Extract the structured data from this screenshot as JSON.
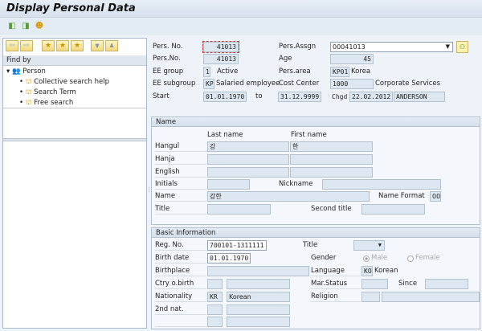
{
  "window": {
    "title": "Display Personal Data"
  },
  "toolbar": {
    "icons": [
      "previous-record-icon",
      "next-record-icon",
      "person-overview-icon"
    ]
  },
  "left_panel": {
    "toolbar_icons": [
      "arrow-left-icon",
      "arrow-right-icon",
      "favorite-add-icon",
      "favorite-icon",
      "favorite-edit-icon",
      "expand-down-icon",
      "collapse-up-icon"
    ],
    "find_by": "Find by",
    "tree": {
      "root": "Person",
      "items": [
        "Collective search help",
        "Search Term",
        "Free search"
      ]
    }
  },
  "header": {
    "pers_no_label": "Pers. No.",
    "pers_no": "41013",
    "pers_no2_label": "Pers.No.",
    "pers_no2": "41013",
    "ee_group_label": "EE group",
    "ee_group_code": "1",
    "ee_group_text": "Active",
    "ee_subgroup_label": "EE subgroup",
    "ee_subgroup_code": "KP",
    "ee_subgroup_text": "Salaried employee",
    "start_label": "Start",
    "start": "01.01.1970",
    "to_label": "to",
    "end": "31.12.9999",
    "pers_assgn_label": "Pers.Assgn",
    "pers_assgn": "00041013",
    "age_label": "Age",
    "age": "45",
    "pers_area_label": "Pers.area",
    "pers_area_code": "KP01",
    "pers_area_text": "Korea",
    "cost_center_label": "Cost Center",
    "cost_center": "1000",
    "cost_center_text": "Corporate Services",
    "chgd_label": "Chgd",
    "chgd_date": "22.02.2012",
    "chgd_by": "ANDERSON"
  },
  "name_group": {
    "title": "Name",
    "last_name_header": "Last name",
    "first_name_header": "First name",
    "hangul_label": "Hangul",
    "hangul_last": "강",
    "hangul_first": "한",
    "hanja_label": "Hanja",
    "english_label": "English",
    "initials_label": "Initials",
    "nickname_label": "Nickname",
    "name_label": "Name",
    "name": "강한",
    "name_format_label": "Name Format",
    "name_format": "00",
    "title_label": "Title",
    "second_title_label": "Second title"
  },
  "basic_info": {
    "title": "Basic Information",
    "reg_no_label": "Reg. No.",
    "reg_no": "700101-1311111",
    "title_label": "Title",
    "birth_date_label": "Birth date",
    "birth_date": "01.01.1970",
    "gender_label": "Gender",
    "gender_male": "Male",
    "gender_female": "Female",
    "gender_selected": "Male",
    "birthplace_label": "Birthplace",
    "language_label": "Language",
    "language_code": "KO",
    "language_text": "Korean",
    "ctry_birth_label": "Ctry o.birth",
    "mar_status_label": "Mar.Status",
    "since_label": "Since",
    "nationality_label": "Nationality",
    "nationality_code": "KR",
    "nationality_text": "Korean",
    "religion_label": "Religion",
    "second_nat_label": "2nd nat."
  }
}
